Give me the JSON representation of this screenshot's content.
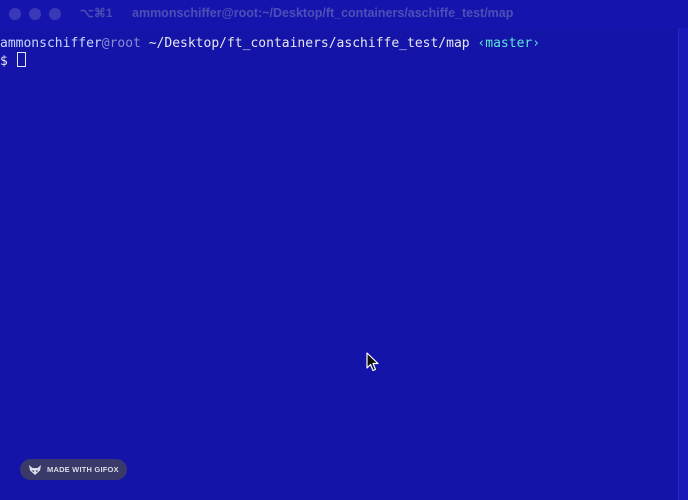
{
  "titlebar": {
    "shortcut": "⌥⌘1",
    "title": "ammonschiffer@root:~/Desktop/ft_containers/aschiffe_test/map"
  },
  "terminal": {
    "prompt": {
      "user": "ammonschiffer",
      "at": "@",
      "host": "root",
      "path": "~/Desktop/ft_containers/aschiffe_test/map",
      "branch": "‹master›"
    },
    "prompt_symbol": "$"
  },
  "watermark": {
    "label": "MADE WITH GIFOX"
  },
  "icons": {
    "close": "close-icon",
    "minimize": "minimize-icon",
    "maximize": "maximize-icon",
    "cursor": "mouse-pointer-icon",
    "gifox": "gifox-fox-icon"
  },
  "colors": {
    "background": "#1414a8",
    "text": "#e6e6f0",
    "branch": "#5ee6d8"
  }
}
